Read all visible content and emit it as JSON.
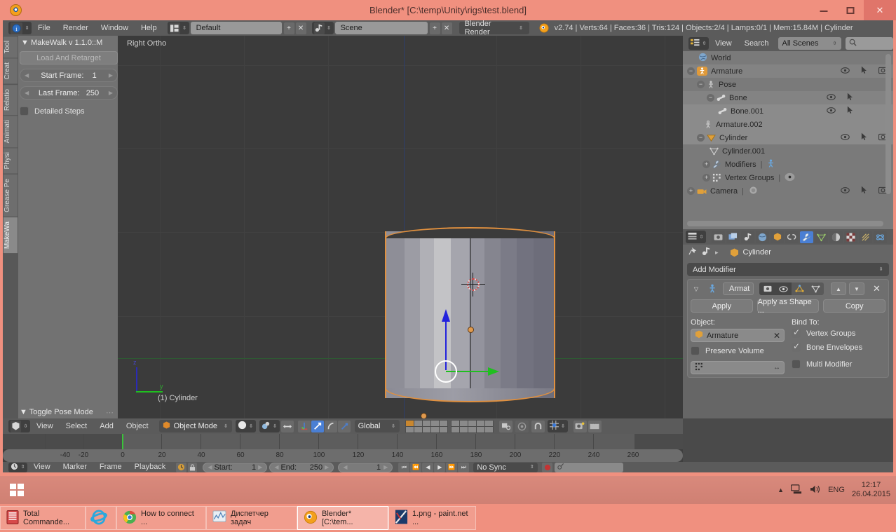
{
  "window": {
    "title": "Blender* [C:\\temp\\Unity\\rigs\\test.blend]",
    "app_icon": "blender-logo-icon",
    "minimize": "−",
    "maximize": "▢",
    "close": "✕"
  },
  "topbar": {
    "editor_type_icon": "info-editor-icon",
    "menus": [
      "File",
      "Render",
      "Window",
      "Help"
    ],
    "screen_layout_icon": "screen-layout-icon",
    "screen_layout": "Default",
    "add_label": "+",
    "remove_label": "✕",
    "scene_icon": "scene-icon",
    "scene": "Scene",
    "engine": "Blender Render",
    "stats_icon": "blender-logo-icon",
    "stats": "v2.74 | Verts:64 | Faces:36 | Tris:124 | Objects:2/4 | Lamps:0/1 | Mem:15.84M | Cylinder"
  },
  "tool_region": {
    "tabs": [
      "Tool",
      "Creat",
      "Relatio",
      "Animati",
      "Physi",
      "Grease Pe",
      "MakeWa"
    ],
    "active_tab": "MakeWa",
    "panel_title": "MakeWalk v 1.1.0::M",
    "panel_arrow": "▼",
    "load_button": "Load And Retarget",
    "start_frame_label": "Start Frame:",
    "start_frame_value": "1",
    "last_frame_label": "Last Frame:",
    "last_frame_value": "250",
    "detailed_steps_label": "Detailed Steps",
    "detailed_steps_checked": false,
    "bottom_panel": "Toggle Pose Mode",
    "bottom_panel_arrow": "▼",
    "bottom_panel_grip": "⋯"
  },
  "viewport": {
    "view_name": "Right Ortho",
    "object_label": "(1) Cylinder",
    "gizmo_z": "z",
    "gizmo_y": "y",
    "object_outline_color": "#e0903f",
    "background_color": "#3b3b3b"
  },
  "viewport_header": {
    "editor_icon": "3d-view-icon",
    "menus": [
      "View",
      "Select",
      "Add",
      "Object"
    ],
    "mode_icon": "object-mode-icon",
    "mode": "Object Mode",
    "shading_icon": "solid-shading-icon",
    "pivot_icon": "pivot-center-icon",
    "snap_magnet_icon": "magnet-icon",
    "manipulator_translate_icon": "translate-manipulator-icon",
    "manipulator_rotate_icon": "rotate-manipulator-icon",
    "manipulator_scale_icon": "scale-manipulator-icon",
    "orientation": "Global",
    "layers_label": "scene-layers",
    "lock_icon": "lock-camera-icon",
    "proportional_icon": "proportional-edit-icon",
    "snap_element_icon": "snap-element-icon",
    "render_icon": "render-preview-icon",
    "viewport_render_icon": "viewport-render-icon"
  },
  "timeline": {
    "ticks": [
      "-40",
      "-20",
      "0",
      "20",
      "40",
      "60",
      "80",
      "100",
      "120",
      "140",
      "160",
      "180",
      "200",
      "220",
      "240",
      "260"
    ],
    "playhead_frame": "1",
    "range_start": "0",
    "range_end": "250"
  },
  "timeline_header": {
    "editor_icon": "timeline-editor-icon",
    "menus": [
      "View",
      "Marker",
      "Frame",
      "Playback"
    ],
    "autokey_icon": "record-icon",
    "lock_icon": "lock-icon",
    "start_label": "Start:",
    "start_value": "1",
    "end_label": "End:",
    "end_value": "250",
    "current_frame": "1",
    "transport": [
      "⏮",
      "⏪",
      "◀",
      "▶",
      "⏩",
      "⏭"
    ],
    "sync_mode": "No Sync",
    "record_icon": "record-dot-icon",
    "key_icon": "keyingset-icon"
  },
  "outliner": {
    "editor_icon": "outliner-editor-icon",
    "menus": [
      "View",
      "Search"
    ],
    "display_mode": "All Scenes",
    "search_icon": "search-icon",
    "rows": [
      {
        "name": "World",
        "icon": "world-icon",
        "indent": 1,
        "expander": "",
        "eye": false,
        "cursor": false,
        "camera": false,
        "selected": false
      },
      {
        "name": "Armature",
        "icon": "armature-icon",
        "indent": 0,
        "expander": "−",
        "eye": true,
        "cursor": true,
        "camera": true,
        "selected": false
      },
      {
        "name": "Pose",
        "icon": "pose-icon",
        "indent": 1,
        "expander": "−",
        "eye": false,
        "cursor": false,
        "camera": false,
        "selected": false
      },
      {
        "name": "Bone",
        "icon": "bone-icon",
        "indent": 2,
        "expander": "−",
        "eye": true,
        "cursor": true,
        "camera": false,
        "selected": false
      },
      {
        "name": "Bone.001",
        "icon": "bone-icon",
        "indent": 3,
        "expander": "",
        "eye": true,
        "cursor": true,
        "camera": false,
        "selected": true
      },
      {
        "name": "Armature.002",
        "icon": "armature-data-icon",
        "indent": 1,
        "expander": "",
        "eye": false,
        "cursor": false,
        "camera": false,
        "selected": true
      },
      {
        "name": "Cylinder",
        "icon": "mesh-object-icon",
        "indent": 1,
        "expander": "−",
        "eye": true,
        "cursor": true,
        "camera": true,
        "selected": true
      },
      {
        "name": "Cylinder.001",
        "icon": "mesh-data-icon",
        "indent": 2,
        "expander": "",
        "eye": false,
        "cursor": false,
        "camera": false,
        "selected": false
      },
      {
        "name": "Modifiers",
        "icon": "wrench-icon",
        "indent": 2,
        "expander": "+",
        "eye": false,
        "cursor": false,
        "camera": false,
        "selected": false,
        "suffix_icon": "armature-modifier-icon"
      },
      {
        "name": "Vertex Groups",
        "icon": "vertexgroup-icon",
        "indent": 2,
        "expander": "+",
        "eye": false,
        "cursor": false,
        "camera": false,
        "selected": false,
        "suffix_icon": "group-dot-icon"
      },
      {
        "name": "Camera",
        "icon": "camera-icon",
        "indent": 0,
        "expander": "+",
        "eye": true,
        "cursor": true,
        "camera": true,
        "selected": false,
        "suffix_icon": "camera-data-icon"
      }
    ]
  },
  "properties": {
    "tabs": [
      {
        "icon": "render-tab-icon",
        "active": false
      },
      {
        "icon": "render-layers-tab-icon",
        "active": false
      },
      {
        "icon": "scene-tab-icon",
        "active": false
      },
      {
        "icon": "world-tab-icon",
        "active": false
      },
      {
        "icon": "object-tab-icon",
        "active": false
      },
      {
        "icon": "constraints-tab-icon",
        "active": false
      },
      {
        "icon": "modifier-tab-icon",
        "active": true
      },
      {
        "icon": "data-tab-icon",
        "active": false
      },
      {
        "icon": "material-tab-icon",
        "active": false
      },
      {
        "icon": "texture-tab-icon",
        "active": false
      },
      {
        "icon": "particles-tab-icon",
        "active": false
      },
      {
        "icon": "physics-tab-icon",
        "active": false
      }
    ],
    "pin_icon": "pin-icon",
    "scene_icon": "scene-icon",
    "breadcrumb_sep": "▸",
    "object_icon": "mesh-object-icon",
    "object_name": "Cylinder",
    "add_modifier": "Add Modifier",
    "modifier": {
      "collapse_icon": "collapse-triangle-icon",
      "type_icon": "armature-modifier-icon",
      "name": "Armat",
      "toggle_render_icon": "render-toggle-icon",
      "toggle_viewport_icon": "eye-toggle-icon",
      "toggle_edit_icon": "editmode-toggle-icon",
      "toggle_cage_icon": "cage-toggle-icon",
      "move_up_icon": "move-up-icon",
      "move_down_icon": "move-down-icon",
      "delete_icon": "delete-x-icon",
      "apply": "Apply",
      "apply_as_shape": "Apply as Shape ...",
      "copy": "Copy",
      "object_label": "Object:",
      "object_value": "Armature",
      "object_clear_icon": "clear-x-icon",
      "object_field_icon": "object-icon",
      "preserve_volume_label": "Preserve Volume",
      "preserve_volume_checked": false,
      "vertex_group_icon": "vertexgroup-icon",
      "vertex_group_value": "",
      "invert_icon": "invert-arrows-icon",
      "bind_to_label": "Bind To:",
      "vertex_groups_label": "Vertex Groups",
      "vertex_groups_checked": true,
      "bone_envelopes_label": "Bone Envelopes",
      "bone_envelopes_checked": true,
      "multi_modifier_label": "Multi Modifier",
      "multi_modifier_checked": false
    }
  },
  "taskbar": {
    "start_icon": "windows-start-icon",
    "items": [
      {
        "label": "Total Commande...",
        "icon": "total-commander-icon",
        "active": false
      },
      {
        "label": "",
        "icon": "ie-browser-icon",
        "active": false,
        "pinned": true
      },
      {
        "label": "How to connect ...",
        "icon": "chrome-icon",
        "active": false
      },
      {
        "label": "Диспетчер задач",
        "icon": "task-manager-icon",
        "active": false
      },
      {
        "label": "Blender* [C:\\tem...",
        "icon": "blender-logo-icon",
        "active": true
      },
      {
        "label": "1.png - paint.net ...",
        "icon": "paint-net-icon",
        "active": false
      }
    ],
    "tray": {
      "expand_icon": "show-hidden-icons-icon",
      "network_icon": "network-icon",
      "volume_icon": "volume-icon",
      "language": "ENG",
      "time": "12:17",
      "date": "26.04.2015"
    }
  }
}
